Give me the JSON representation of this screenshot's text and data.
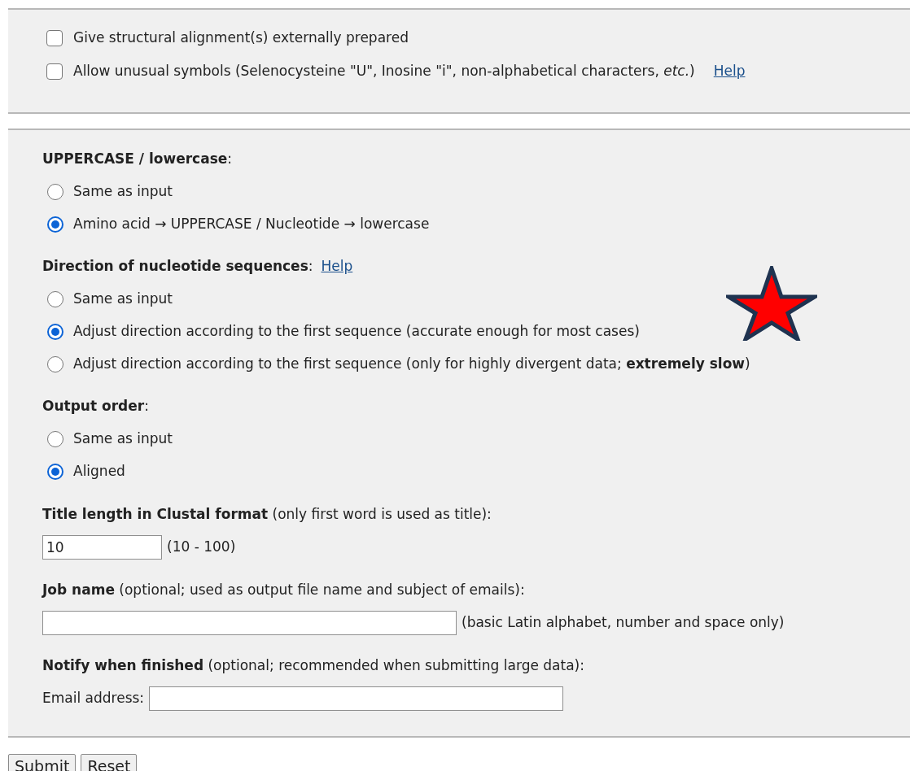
{
  "extra_options": {
    "checkboxes": [
      {
        "label": "Give structural alignment(s) externally prepared",
        "checked": false
      },
      {
        "label": "Allow unusual symbols (Selenocysteine \"U\", Inosine \"i\", non-alphabetical characters, *etc.*)",
        "checked": false,
        "help_link": "Help"
      }
    ]
  },
  "output_settings": {
    "radio_groups": [
      {
        "heading": "**UPPERCASE / lowercase**:",
        "options": [
          {
            "label": "Same as input",
            "selected": false
          },
          {
            "label": "Amino acid → UPPERCASE / Nucleotide → lowercase",
            "selected": true
          }
        ]
      },
      {
        "heading": "**Direction of nucleotide sequences**:",
        "help_link": "Help",
        "options": [
          {
            "label": "Same as input",
            "selected": false
          },
          {
            "label": "Adjust direction according to the first sequence (accurate enough for most cases)",
            "selected": true
          },
          {
            "label": "Adjust direction according to the first sequence (only for highly divergent data; **extremely slow**)",
            "selected": false
          }
        ]
      },
      {
        "heading": "**Output order**:",
        "options": [
          {
            "label": "Same as input",
            "selected": false
          },
          {
            "label": "Aligned",
            "selected": true
          }
        ]
      }
    ],
    "fields": [
      {
        "heading": "**Title length in Clustal format** (only first word is used as title):",
        "value": "10",
        "note": "(10 - 100)",
        "kind": "short"
      },
      {
        "heading": "**Job name** (optional; used as output file name and subject of emails):",
        "note": "(basic Latin alphabet, number and space only)",
        "kind": "long"
      },
      {
        "heading": "**Notify when finished** (optional; recommended when submitting large data):",
        "label": "Email address:",
        "kind": "long"
      }
    ]
  },
  "buttons": [
    "Submit",
    "Reset"
  ]
}
